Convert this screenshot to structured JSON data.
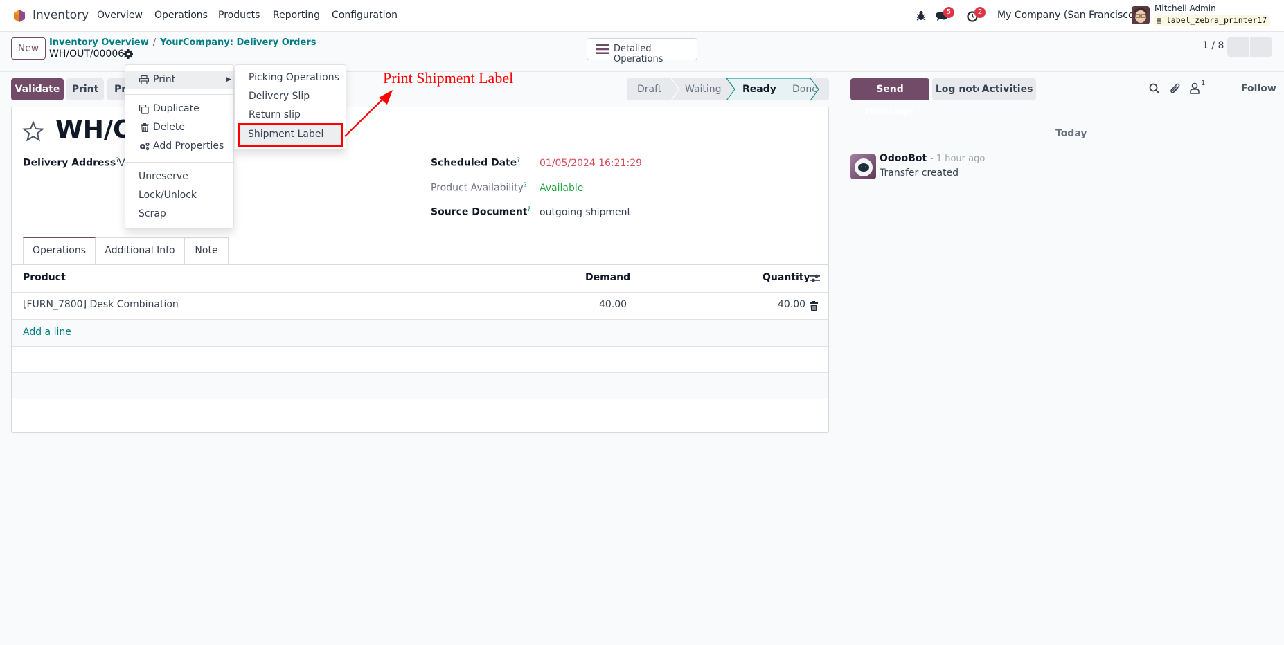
{
  "navbar": {
    "app_name": "Inventory",
    "menu": [
      "Overview",
      "Operations",
      "Products",
      "Reporting",
      "Configuration"
    ],
    "icons": [
      "bug-icon",
      "chat-icon",
      "clock-icon"
    ],
    "messages_count": "5",
    "activities_count": "2",
    "company": "My Company (San Francisco)",
    "user_name": "Mitchell Admin",
    "database": "label_zebra_printer17"
  },
  "control_panel": {
    "new_label": "New",
    "breadcrumb": [
      "Inventory Overview",
      "YourCompany: Delivery Orders"
    ],
    "breadcrumb_sep": "/",
    "record_name": "WH/OUT/00006",
    "detailed_operations_label": "Detailed Operations",
    "pager": "1 / 8"
  },
  "actions": {
    "validate": "Validate",
    "print": "Print",
    "print_partial": "Pr"
  },
  "statusbar": {
    "stages": [
      "Draft",
      "Waiting",
      "Ready",
      "Done"
    ],
    "active": "Ready",
    "active_color": "#017e84"
  },
  "form": {
    "title": "WH/OU",
    "delivery_address_label": "Delivery Address",
    "delivery_address_value": "V",
    "help_mark": "?",
    "scheduled_date_label": "Scheduled Date",
    "scheduled_date_value": "01/05/2024 16:21:29",
    "scheduled_date_color": "#d44c59",
    "availability_label": "Product Availability",
    "availability_value": "Available",
    "availability_color": "#28a745",
    "source_document_label": "Source Document",
    "source_document_value": "outgoing shipment",
    "tabs": [
      "Operations",
      "Additional Info",
      "Note"
    ],
    "active_tab": "Operations",
    "table": {
      "headers": [
        "Product",
        "Demand",
        "Quantity"
      ],
      "rows": [
        {
          "product": "[FURN_7800] Desk Combination",
          "demand": "40.00",
          "quantity": "40.00"
        }
      ],
      "add_line": "Add a line"
    }
  },
  "dropdown": {
    "print_label": "Print",
    "items": [
      "Duplicate",
      "Delete",
      "Add Properties"
    ],
    "items2": [
      "Unreserve",
      "Lock/Unlock",
      "Scrap"
    ],
    "submenu": [
      "Picking Operations",
      "Delivery Slip",
      "Return slip",
      "Shipment Label"
    ],
    "highlighted": "Shipment Label"
  },
  "annotation": {
    "text": "Print Shipment Label",
    "color": "#ff0000"
  },
  "chatter": {
    "send_message": "Send message",
    "log_note": "Log note",
    "activities": "Activities",
    "followers_count": "1",
    "follow": "Follow",
    "date_separator": "Today",
    "messages": [
      {
        "author": "OdooBot",
        "time": "- 1 hour ago",
        "body": "Transfer created"
      }
    ]
  },
  "colors": {
    "brand": "#714b67",
    "link": "#017e84"
  }
}
